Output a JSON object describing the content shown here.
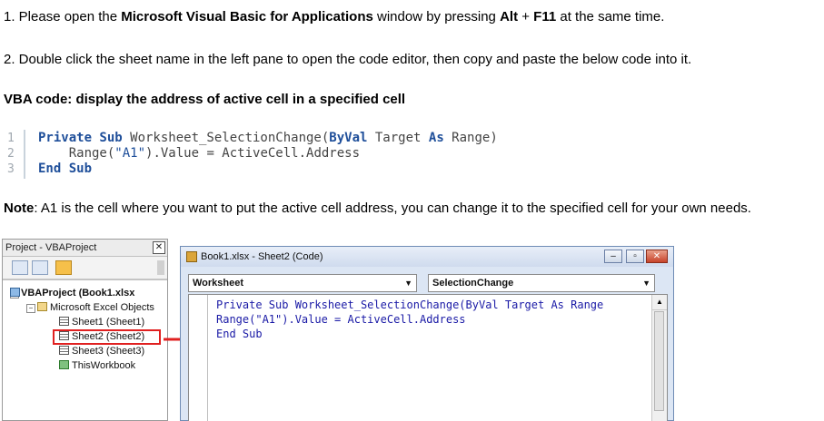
{
  "step1": {
    "prefix": "1. Please open the ",
    "bold1": "Microsoft Visual Basic for Applications",
    "mid": " window by pressing ",
    "key1": "Alt",
    "plus": " + ",
    "key2": "F11",
    "suffix": " at the same time."
  },
  "step2": {
    "text": "2. Double click the sheet name in the left pane to open the code editor, then copy and paste the below code into it."
  },
  "heading": "VBA code: display the address of active cell in a specified cell",
  "code": {
    "line_numbers": [
      "1",
      "2",
      "3"
    ],
    "line1": {
      "kw1": "Private Sub",
      "plain1": " Worksheet_SelectionChange(",
      "kw2": "ByVal",
      "plain2": " Target ",
      "kw3": "As",
      "plain3": " Range)"
    },
    "line2": {
      "plain1": "    Range(",
      "str": "\"A1\"",
      "plain2": ").Value = ActiveCell.Address"
    },
    "line3": {
      "kw1": "End Sub"
    }
  },
  "note": {
    "label": "Note",
    "text": ": A1 is the cell where you want to put the active cell address, you can change it to the specified cell for your own needs."
  },
  "screenshot": {
    "project_pane": {
      "title": "Project - VBAProject",
      "close": "✕",
      "tree": {
        "root": "VBAProject (Book1.xlsx",
        "folder": "Microsoft Excel Objects",
        "sheet1": "Sheet1 (Sheet1)",
        "sheet2": "Sheet2 (Sheet2)",
        "sheet3": "Sheet3 (Sheet3)",
        "workbook": "ThisWorkbook"
      }
    },
    "code_window": {
      "title": "Book1.xlsx - Sheet2 (Code)",
      "object_combo": "Worksheet",
      "procedure_combo": "SelectionChange",
      "lines": [
        "Private Sub Worksheet_SelectionChange(ByVal Target As Range",
        "Range(\"A1\").Value = ActiveCell.Address",
        "End Sub"
      ]
    },
    "colors": {
      "highlight": "#e02020",
      "keyword": "#1f4f9a"
    }
  }
}
